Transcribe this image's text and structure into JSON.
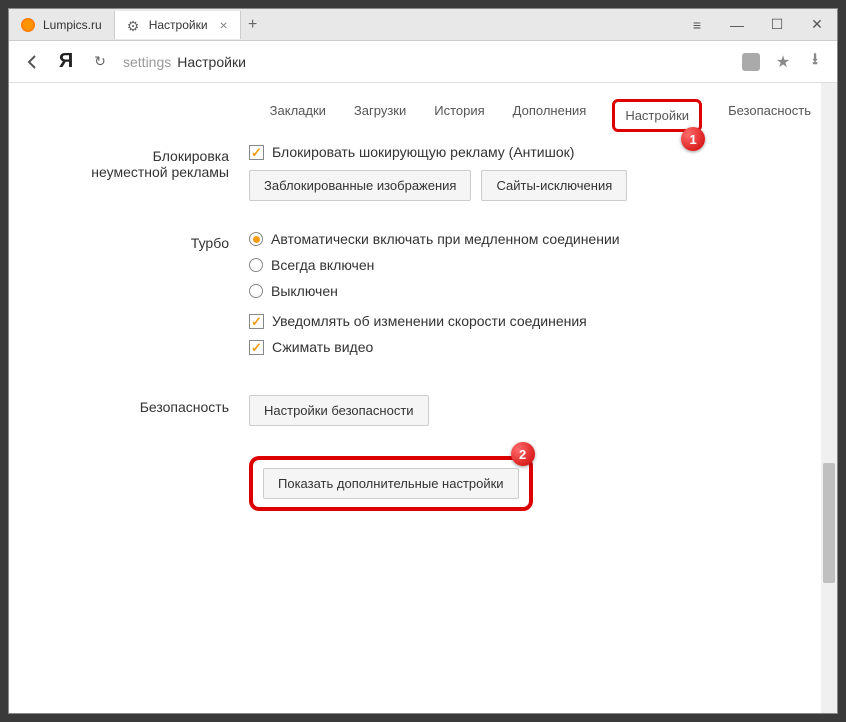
{
  "tabs": {
    "tab1": "Lumpics.ru",
    "tab2": "Настройки"
  },
  "addressbar": {
    "path": "settings",
    "title": "Настройки"
  },
  "topnav": {
    "bookmarks": "Закладки",
    "downloads": "Загрузки",
    "history": "История",
    "addons": "Дополнения",
    "settings": "Настройки",
    "security": "Безопасность"
  },
  "badges": {
    "one": "1",
    "two": "2"
  },
  "sections": {
    "adblock": {
      "label_l1": "Блокировка",
      "label_l2": "неуместной рекламы",
      "check1": "Блокировать шокирующую рекламу (Антишок)",
      "btn1": "Заблокированные изображения",
      "btn2": "Сайты-исключения"
    },
    "turbo": {
      "label": "Турбо",
      "radio1": "Автоматически включать при медленном соединении",
      "radio2": "Всегда включен",
      "radio3": "Выключен",
      "check1": "Уведомлять об изменении скорости соединения",
      "check2": "Сжимать видео"
    },
    "security": {
      "label": "Безопасность",
      "btn": "Настройки безопасности"
    },
    "advanced": {
      "btn": "Показать дополнительные настройки"
    }
  }
}
